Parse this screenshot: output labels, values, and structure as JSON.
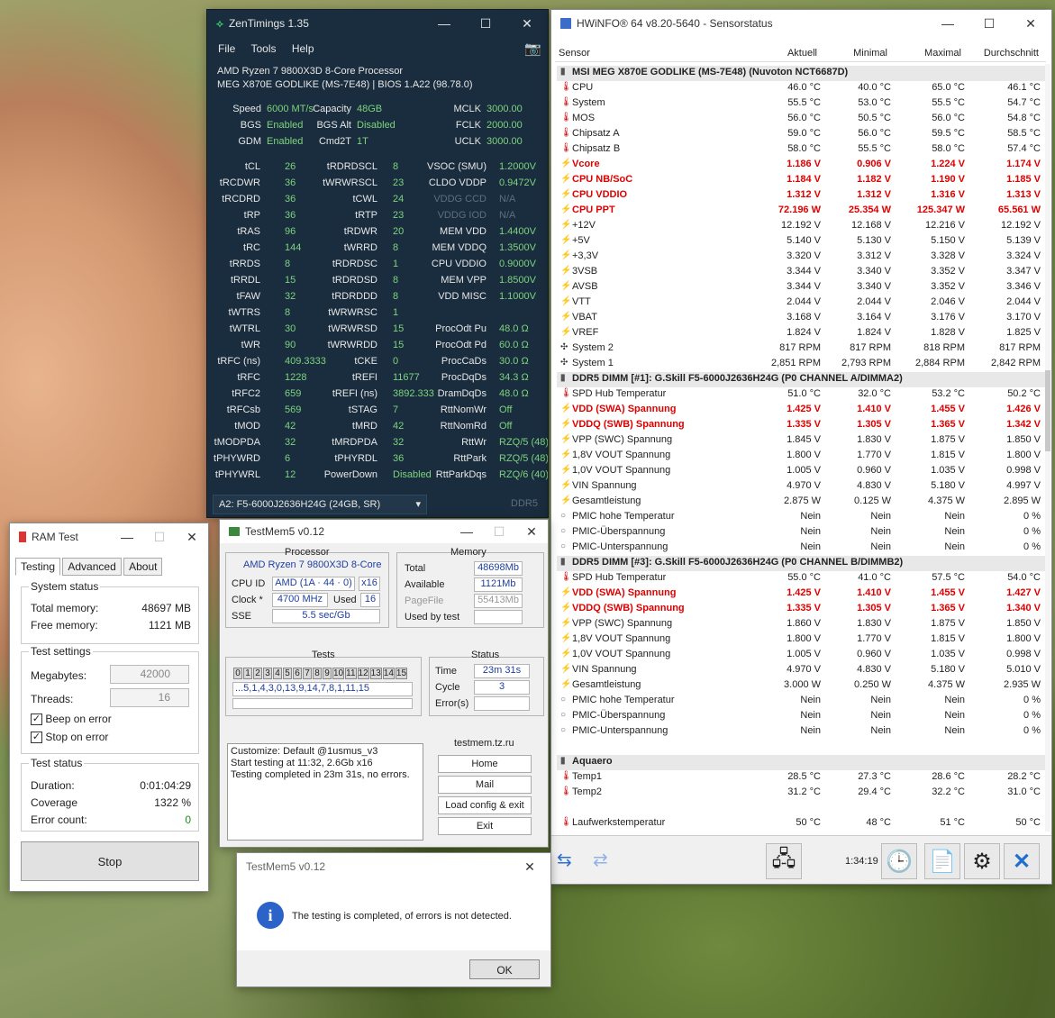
{
  "zen": {
    "title": "ZenTimings 1.35",
    "menu": [
      "File",
      "Tools",
      "Help"
    ],
    "cpu": "AMD Ryzen 7 9800X3D 8-Core Processor",
    "board": "MEG X870E GODLIKE (MS-7E48) | BIOS 1.A22 (98.78.0)",
    "top": [
      [
        "Speed",
        "6000 MT/s",
        "Capacity",
        "48GB",
        "MCLK",
        "3000.00"
      ],
      [
        "BGS",
        "Enabled",
        "BGS Alt",
        "Disabled",
        "FCLK",
        "2000.00"
      ],
      [
        "GDM",
        "Enabled",
        "Cmd2T",
        "1T",
        "UCLK",
        "3000.00"
      ]
    ],
    "rows": [
      [
        "tCL",
        "26",
        "tRDRDSCL",
        "8",
        "VSOC (SMU)",
        "1.2000V"
      ],
      [
        "tRCDWR",
        "36",
        "tWRWRSCL",
        "23",
        "CLDO VDDP",
        "0.9472V"
      ],
      [
        "tRCDRD",
        "36",
        "tCWL",
        "24",
        "VDDG CCD",
        "N/A"
      ],
      [
        "tRP",
        "36",
        "tRTP",
        "23",
        "VDDG IOD",
        "N/A"
      ],
      [
        "tRAS",
        "96",
        "tRDWR",
        "20",
        "MEM VDD",
        "1.4400V"
      ],
      [
        "tRC",
        "144",
        "tWRRD",
        "8",
        "MEM VDDQ",
        "1.3500V"
      ],
      [
        "tRRDS",
        "8",
        "tRDRDSC",
        "1",
        "CPU VDDIO",
        "0.9000V"
      ],
      [
        "tRRDL",
        "15",
        "tRDRDSD",
        "8",
        "MEM VPP",
        "1.8500V"
      ],
      [
        "tFAW",
        "32",
        "tRDRDDD",
        "8",
        "VDD MISC",
        "1.1000V"
      ],
      [
        "tWTRS",
        "8",
        "tWRWRSC",
        "1",
        "",
        ""
      ],
      [
        "tWTRL",
        "30",
        "tWRWRSD",
        "15",
        "ProcOdt Pu",
        "48.0 Ω"
      ],
      [
        "tWR",
        "90",
        "tWRWRDD",
        "15",
        "ProcOdt Pd",
        "60.0 Ω"
      ],
      [
        "tRFC (ns)",
        "409.3333",
        "tCKE",
        "0",
        "ProcCaDs",
        "30.0 Ω"
      ],
      [
        "tRFC",
        "1228",
        "tREFI",
        "11677",
        "ProcDqDs",
        "34.3 Ω"
      ],
      [
        "tRFC2",
        "659",
        "tREFI (ns)",
        "3892.333",
        "DramDqDs",
        "48.0 Ω"
      ],
      [
        "tRFCsb",
        "569",
        "tSTAG",
        "7",
        "RttNomWr",
        "Off"
      ],
      [
        "tMOD",
        "42",
        "tMRD",
        "42",
        "RttNomRd",
        "Off"
      ],
      [
        "tMODPDA",
        "32",
        "tMRDPDA",
        "32",
        "RttWr",
        "RZQ/5 (48)"
      ],
      [
        "tPHYWRD",
        "6",
        "tPHYRDL",
        "36",
        "RttPark",
        "RZQ/5 (48)"
      ],
      [
        "tPHYWRL",
        "12",
        "PowerDown",
        "Disabled",
        "RttParkDqs",
        "RZQ/6 (40)"
      ]
    ],
    "module": "A2: F5-6000J2636H24G (24GB, SR)",
    "ddr": "DDR5"
  },
  "hw": {
    "title": "HWiNFO® 64 v8.20-5640 - Sensorstatus",
    "cols": [
      "Sensor",
      "Aktuell",
      "Minimal",
      "Maximal",
      "Durchschnitt"
    ],
    "rows": [
      {
        "t": "g",
        "n": "MSI MEG X870E GODLIKE (MS-7E48) (Nuvoton NCT6687D)"
      },
      {
        "t": "T",
        "n": "CPU",
        "v": [
          "46.0 °C",
          "40.0 °C",
          "65.0 °C",
          "46.1 °C"
        ]
      },
      {
        "t": "T",
        "n": "System",
        "v": [
          "55.5 °C",
          "53.0 °C",
          "55.5 °C",
          "54.7 °C"
        ]
      },
      {
        "t": "T",
        "n": "MOS",
        "v": [
          "56.0 °C",
          "50.5 °C",
          "56.0 °C",
          "54.8 °C"
        ]
      },
      {
        "t": "T",
        "n": "Chipsatz A",
        "v": [
          "59.0 °C",
          "56.0 °C",
          "59.5 °C",
          "58.5 °C"
        ]
      },
      {
        "t": "T",
        "n": "Chipsatz B",
        "v": [
          "58.0 °C",
          "55.5 °C",
          "58.0 °C",
          "57.4 °C"
        ]
      },
      {
        "t": "V",
        "r": 1,
        "n": "Vcore",
        "v": [
          "1.186 V",
          "0.906 V",
          "1.224 V",
          "1.174 V"
        ]
      },
      {
        "t": "V",
        "r": 1,
        "n": "CPU NB/SoC",
        "v": [
          "1.184 V",
          "1.182 V",
          "1.190 V",
          "1.185 V"
        ]
      },
      {
        "t": "V",
        "r": 1,
        "n": "CPU VDDIO",
        "v": [
          "1.312 V",
          "1.312 V",
          "1.316 V",
          "1.313 V"
        ]
      },
      {
        "t": "V",
        "r": 1,
        "n": "CPU PPT",
        "v": [
          "72.196 W",
          "25.354 W",
          "125.347 W",
          "65.561 W"
        ]
      },
      {
        "t": "V",
        "n": "+12V",
        "v": [
          "12.192 V",
          "12.168 V",
          "12.216 V",
          "12.192 V"
        ]
      },
      {
        "t": "V",
        "n": "+5V",
        "v": [
          "5.140 V",
          "5.130 V",
          "5.150 V",
          "5.139 V"
        ]
      },
      {
        "t": "V",
        "n": "+3,3V",
        "v": [
          "3.320 V",
          "3.312 V",
          "3.328 V",
          "3.324 V"
        ]
      },
      {
        "t": "V",
        "n": "3VSB",
        "v": [
          "3.344 V",
          "3.340 V",
          "3.352 V",
          "3.347 V"
        ]
      },
      {
        "t": "V",
        "n": "AVSB",
        "v": [
          "3.344 V",
          "3.340 V",
          "3.352 V",
          "3.346 V"
        ]
      },
      {
        "t": "V",
        "n": "VTT",
        "v": [
          "2.044 V",
          "2.044 V",
          "2.046 V",
          "2.044 V"
        ]
      },
      {
        "t": "V",
        "n": "VBAT",
        "v": [
          "3.168 V",
          "3.164 V",
          "3.176 V",
          "3.170 V"
        ]
      },
      {
        "t": "V",
        "n": "VREF",
        "v": [
          "1.824 V",
          "1.824 V",
          "1.828 V",
          "1.825 V"
        ]
      },
      {
        "t": "F",
        "n": "System 2",
        "v": [
          "817 RPM",
          "817 RPM",
          "818 RPM",
          "817 RPM"
        ]
      },
      {
        "t": "F",
        "n": "System 1",
        "v": [
          "2,851 RPM",
          "2,793 RPM",
          "2,884 RPM",
          "2,842 RPM"
        ]
      },
      {
        "t": "g",
        "n": "DDR5 DIMM [#1]: G.Skill F5-6000J2636H24G (P0 CHANNEL A/DIMMA2)"
      },
      {
        "t": "T",
        "n": "SPD Hub Temperatur",
        "v": [
          "51.0 °C",
          "32.0 °C",
          "53.2 °C",
          "50.2 °C"
        ]
      },
      {
        "t": "V",
        "r": 1,
        "n": "VDD (SWA) Spannung",
        "v": [
          "1.425 V",
          "1.410 V",
          "1.455 V",
          "1.426 V"
        ]
      },
      {
        "t": "V",
        "r": 1,
        "n": "VDDQ (SWB) Spannung",
        "v": [
          "1.335 V",
          "1.305 V",
          "1.365 V",
          "1.342 V"
        ]
      },
      {
        "t": "V",
        "n": "VPP (SWC) Spannung",
        "v": [
          "1.845 V",
          "1.830 V",
          "1.875 V",
          "1.850 V"
        ]
      },
      {
        "t": "V",
        "n": "1,8V VOUT Spannung",
        "v": [
          "1.800 V",
          "1.770 V",
          "1.815 V",
          "1.800 V"
        ]
      },
      {
        "t": "V",
        "n": "1,0V VOUT Spannung",
        "v": [
          "1.005 V",
          "0.960 V",
          "1.035 V",
          "0.998 V"
        ]
      },
      {
        "t": "V",
        "n": "VIN Spannung",
        "v": [
          "4.970 V",
          "4.830 V",
          "5.180 V",
          "4.997 V"
        ]
      },
      {
        "t": "V",
        "n": "Gesamtleistung",
        "v": [
          "2.875 W",
          "0.125 W",
          "4.375 W",
          "2.895 W"
        ]
      },
      {
        "t": "C",
        "n": "PMIC hohe Temperatur",
        "v": [
          "Nein",
          "Nein",
          "Nein",
          "0 %"
        ]
      },
      {
        "t": "C",
        "n": "PMIC-Überspannung",
        "v": [
          "Nein",
          "Nein",
          "Nein",
          "0 %"
        ]
      },
      {
        "t": "C",
        "n": "PMIC-Unterspannung",
        "v": [
          "Nein",
          "Nein",
          "Nein",
          "0 %"
        ]
      },
      {
        "t": "g",
        "n": "DDR5 DIMM [#3]: G.Skill F5-6000J2636H24G (P0 CHANNEL B/DIMMB2)"
      },
      {
        "t": "T",
        "n": "SPD Hub Temperatur",
        "v": [
          "55.0 °C",
          "41.0 °C",
          "57.5 °C",
          "54.0 °C"
        ]
      },
      {
        "t": "V",
        "r": 1,
        "n": "VDD (SWA) Spannung",
        "v": [
          "1.425 V",
          "1.410 V",
          "1.455 V",
          "1.427 V"
        ]
      },
      {
        "t": "V",
        "r": 1,
        "n": "VDDQ (SWB) Spannung",
        "v": [
          "1.335 V",
          "1.305 V",
          "1.365 V",
          "1.340 V"
        ]
      },
      {
        "t": "V",
        "n": "VPP (SWC) Spannung",
        "v": [
          "1.860 V",
          "1.830 V",
          "1.875 V",
          "1.850 V"
        ]
      },
      {
        "t": "V",
        "n": "1,8V VOUT Spannung",
        "v": [
          "1.800 V",
          "1.770 V",
          "1.815 V",
          "1.800 V"
        ]
      },
      {
        "t": "V",
        "n": "1,0V VOUT Spannung",
        "v": [
          "1.005 V",
          "0.960 V",
          "1.035 V",
          "0.998 V"
        ]
      },
      {
        "t": "V",
        "n": "VIN Spannung",
        "v": [
          "4.970 V",
          "4.830 V",
          "5.180 V",
          "5.010 V"
        ]
      },
      {
        "t": "V",
        "n": "Gesamtleistung",
        "v": [
          "3.000 W",
          "0.250 W",
          "4.375 W",
          "2.935 W"
        ]
      },
      {
        "t": "C",
        "n": "PMIC hohe Temperatur",
        "v": [
          "Nein",
          "Nein",
          "Nein",
          "0 %"
        ]
      },
      {
        "t": "C",
        "n": "PMIC-Überspannung",
        "v": [
          "Nein",
          "Nein",
          "Nein",
          "0 %"
        ]
      },
      {
        "t": "C",
        "n": "PMIC-Unterspannung",
        "v": [
          "Nein",
          "Nein",
          "Nein",
          "0 %"
        ]
      },
      {
        "t": "s"
      },
      {
        "t": "g",
        "n": "Aquaero"
      },
      {
        "t": "T",
        "n": "Temp1",
        "v": [
          "28.5 °C",
          "27.3 °C",
          "28.6 °C",
          "28.2 °C"
        ]
      },
      {
        "t": "T",
        "n": "Temp2",
        "v": [
          "31.2 °C",
          "29.4 °C",
          "32.2 °C",
          "31.0 °C"
        ]
      },
      {
        "t": "s"
      },
      {
        "t": "T",
        "n": "Laufwerkstemperatur",
        "v": [
          "50 °C",
          "48 °C",
          "51 °C",
          "50 °C"
        ]
      }
    ],
    "time": "1:34:19"
  },
  "ram": {
    "title": "RAM Test",
    "tabs": [
      "Testing",
      "Advanced",
      "About"
    ],
    "system_status": "System status",
    "total_label": "Total memory:",
    "total": "48697 MB",
    "free_label": "Free memory:",
    "free": "1121 MB",
    "settings": "Test settings",
    "mb_label": "Megabytes:",
    "mb": "42000",
    "threads_label": "Threads:",
    "threads": "16",
    "beep": "Beep on error",
    "stop_on_error": "Stop on error",
    "test_status": "Test status",
    "dur_label": "Duration:",
    "dur": "0:01:04:29",
    "cov_label": "Coverage",
    "cov": "1322 %",
    "err_label": "Error count:",
    "err": "0",
    "stop": "Stop"
  },
  "tm": {
    "title": "TestMem5 v0.12",
    "processor": "Processor",
    "cpu": "AMD Ryzen 7 9800X3D 8-Core",
    "cpuid_label": "CPU ID",
    "cpuid": "AMD  (1A · 44 · 0)",
    "cpuid_x": "x16",
    "clock_label": "Clock *",
    "clock": "4700 MHz",
    "used_label": "Used",
    "used": "16",
    "sse_label": "SSE",
    "sse": "5.5 sec/Gb",
    "memory": "Memory",
    "total_label": "Total",
    "total": "48698Mb",
    "avail_label": "Available",
    "avail": "1121Mb",
    "pf_label": "PageFile",
    "pf": "55413Mb",
    "ubt_label": "Used by test",
    "ubt": "",
    "tests": "Tests",
    "test_nums": [
      "0",
      "1",
      "2",
      "3",
      "4",
      "5",
      "6",
      "7",
      "8",
      "9",
      "10",
      "11",
      "12",
      "13",
      "14",
      "15"
    ],
    "seq": "...5,1,4,3,0,13,9,14,7,8,1,11,15",
    "status": "Status",
    "time_label": "Time",
    "time": "23m 31s",
    "cycle_label": "Cycle",
    "cycle": "3",
    "errors_label": "Error(s)",
    "errors": "",
    "log": [
      "Customize: Default @1usmus_v3",
      "Start testing at 11:32, 2.6Gb x16",
      "Testing completed in 23m 31s, no errors."
    ],
    "site": "testmem.tz.ru",
    "buttons": [
      "Home",
      "Mail",
      "Load config & exit",
      "Exit"
    ]
  },
  "dlg": {
    "title": "TestMem5 v0.12",
    "msg": "The testing is completed, of errors is not detected.",
    "ok": "OK"
  }
}
